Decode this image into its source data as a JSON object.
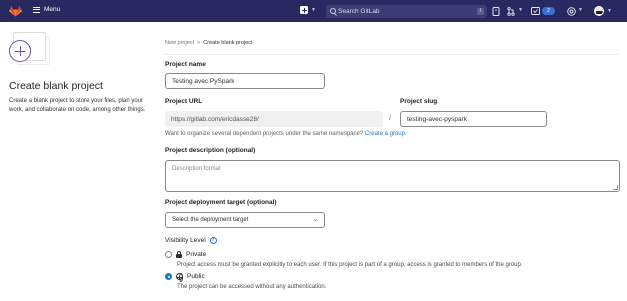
{
  "navbar": {
    "menu_label": "Menu",
    "search_placeholder": "Search GitLab",
    "search_shortcut": "/",
    "mr_count": "2",
    "colors": {
      "background": "#292961",
      "logo": "#fc6d26",
      "badge": "#3b6fd6"
    }
  },
  "left_panel": {
    "title": "Create blank project",
    "description": "Create a blank project to store your files, plan your work, and collaborate on code, among other things."
  },
  "breadcrumb": {
    "parent": "New project",
    "separator": ">",
    "current": "Create blank project"
  },
  "form": {
    "project_name": {
      "label": "Project name",
      "value": "Testing avec PySpark"
    },
    "project_url": {
      "label": "Project URL",
      "value": "https://gitlab.com/ericdasse28/"
    },
    "url_separator": "/",
    "project_slug": {
      "label": "Project slug",
      "value": "testing-avec-pyspark"
    },
    "namespace_help": "Want to organize several dependent projects under the same namespace?",
    "namespace_link": "Create a group.",
    "description": {
      "label": "Project description (optional)",
      "placeholder": "Description format"
    },
    "deployment": {
      "label": "Project deployment target (optional)",
      "selected": "Select the deployment target"
    },
    "visibility": {
      "label": "Visibility Level",
      "help_icon_text": "?",
      "options": [
        {
          "label": "Private",
          "description": "Project access must be granted explicitly to each user. If this project is part of a group, access is granted to members of the group.",
          "checked": false
        },
        {
          "label": "Public",
          "description": "The project can be accessed without any authentication.",
          "checked": true
        }
      ]
    }
  },
  "accent_color": "#1f75cb"
}
